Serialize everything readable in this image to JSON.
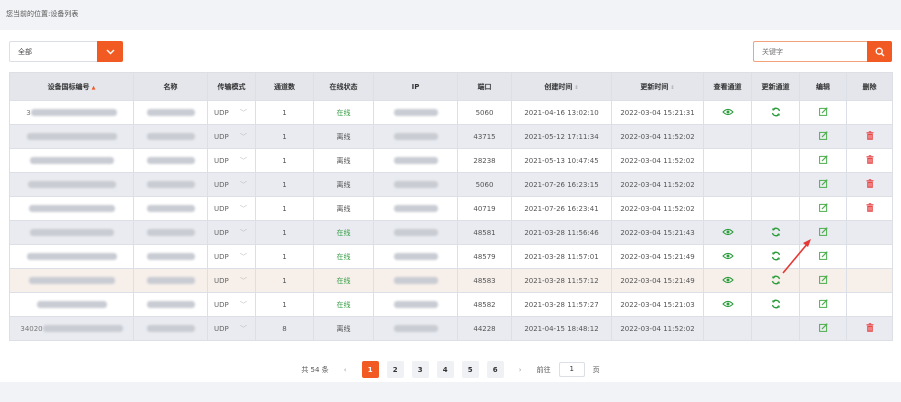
{
  "breadcrumb": {
    "prefix": "您当前的位置:",
    "current": "设备列表"
  },
  "filter": {
    "selected": "全部"
  },
  "search": {
    "placeholder": "关键字"
  },
  "colors": {
    "accent": "#f25a24",
    "online": "#3aa04a",
    "edit": "#4cae4c",
    "delete": "#e84a4a",
    "refresh": "#2f9e3f"
  },
  "table": {
    "headers": [
      "设备国标编号",
      "名称",
      "传输模式",
      "通道数",
      "在线状态",
      "IP",
      "端口",
      "创建时间",
      "更新时间",
      "查看通道",
      "更新通道",
      "编辑",
      "删除"
    ],
    "rows": [
      {
        "id_prefix": "3",
        "mode": "UDP",
        "channels": "1",
        "status": "在线",
        "online": true,
        "port": "5060",
        "created": "2021-04-16 13:02:10",
        "updated": "2022-03-04 15:21:31",
        "view": true,
        "refresh": true,
        "del": false
      },
      {
        "id_prefix": "",
        "mode": "UDP",
        "channels": "1",
        "status": "离线",
        "online": false,
        "port": "43715",
        "created": "2021-05-12 17:11:34",
        "updated": "2022-03-04 11:52:02",
        "view": false,
        "refresh": false,
        "del": true
      },
      {
        "id_prefix": "",
        "mode": "UDP",
        "channels": "1",
        "status": "离线",
        "online": false,
        "port": "28238",
        "created": "2021-05-13 10:47:45",
        "updated": "2022-03-04 11:52:02",
        "view": false,
        "refresh": false,
        "del": true
      },
      {
        "id_prefix": "",
        "mode": "UDP",
        "channels": "1",
        "status": "离线",
        "online": false,
        "port": "5060",
        "created": "2021-07-26 16:23:15",
        "updated": "2022-03-04 11:52:02",
        "view": false,
        "refresh": false,
        "del": true
      },
      {
        "id_prefix": "",
        "mode": "UDP",
        "channels": "1",
        "status": "离线",
        "online": false,
        "port": "40719",
        "created": "2021-07-26 16:23:41",
        "updated": "2022-03-04 11:52:02",
        "view": false,
        "refresh": false,
        "del": true
      },
      {
        "id_prefix": "",
        "mode": "UDP",
        "channels": "1",
        "status": "在线",
        "online": true,
        "port": "48581",
        "created": "2021-03-28 11:56:46",
        "updated": "2022-03-04 15:21:43",
        "view": true,
        "refresh": true,
        "del": false
      },
      {
        "id_prefix": "",
        "mode": "UDP",
        "channels": "1",
        "status": "在线",
        "online": true,
        "port": "48579",
        "created": "2021-03-28 11:57:01",
        "updated": "2022-03-04 15:21:49",
        "view": true,
        "refresh": true,
        "del": false
      },
      {
        "id_prefix": "",
        "mode": "UDP",
        "channels": "1",
        "status": "在线",
        "online": true,
        "port": "48583",
        "created": "2021-03-28 11:57:12",
        "updated": "2022-03-04 15:21:49",
        "view": true,
        "refresh": true,
        "del": false
      },
      {
        "id_prefix": "",
        "mode": "UDP",
        "channels": "1",
        "status": "在线",
        "online": true,
        "port": "48582",
        "created": "2021-03-28 11:57:27",
        "updated": "2022-03-04 15:21:03",
        "view": true,
        "refresh": true,
        "del": false
      },
      {
        "id_prefix": "34020",
        "mode": "UDP",
        "channels": "8",
        "status": "离线",
        "online": false,
        "port": "44228",
        "created": "2021-04-15 18:48:12",
        "updated": "2022-03-04 11:52:02",
        "view": false,
        "refresh": false,
        "del": true
      }
    ]
  },
  "pagination": {
    "total": "共 54 条",
    "pages": [
      "1",
      "2",
      "3",
      "4",
      "5",
      "6"
    ],
    "current": "1",
    "goto_label": "前往",
    "goto_value": "1",
    "page_suffix": "页"
  }
}
